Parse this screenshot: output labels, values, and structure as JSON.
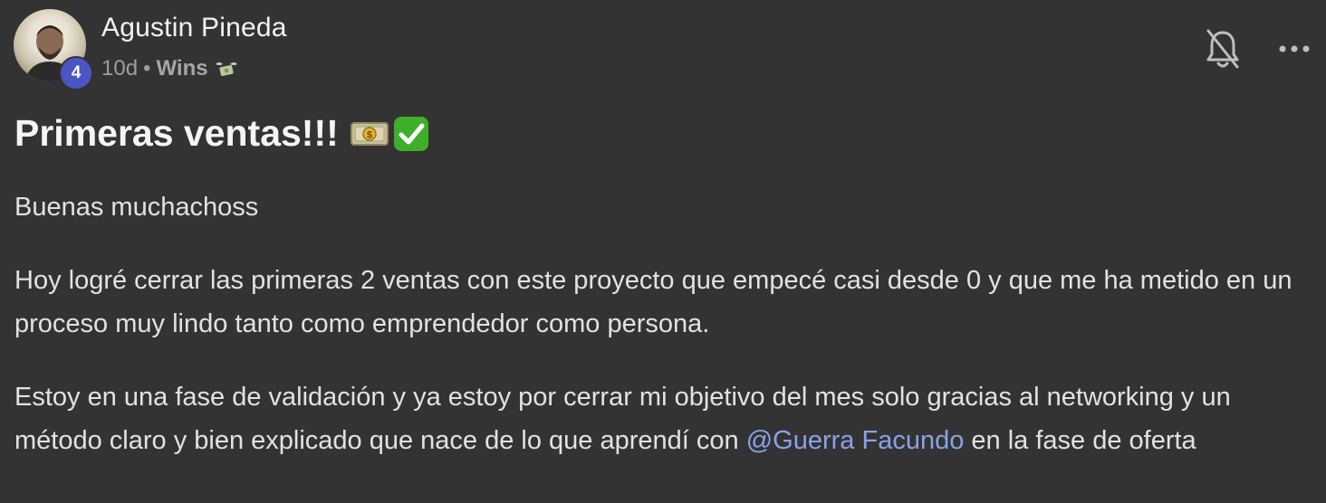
{
  "post": {
    "author": "Agustin Pineda",
    "level": "4",
    "time": "10d",
    "separator": "•",
    "category": "Wins",
    "title": "Primeras ventas!!!",
    "paragraph1": "Buenas muchachoss",
    "paragraph2": "Hoy logré cerrar las primeras 2 ventas con este proyecto que empecé casi desde 0 y que me ha metido en un proceso muy lindo tanto como emprendedor como persona.",
    "paragraph3_before": "Estoy en una fase de validación y ya estoy por cerrar mi objetivo del mes solo gracias al networking y un método claro y bien explicado que nace de lo que aprendí con ",
    "mention": "@Guerra Facundo",
    "paragraph3_after": " en la fase de oferta"
  },
  "icons": {
    "category": "money-with-wings-icon",
    "title_emoji_1": "dollar-banknote-icon",
    "title_emoji_2": "check-mark-button-icon",
    "notifications": "bell-off-icon",
    "more": "more-options-icon"
  },
  "colors": {
    "background": "#333333",
    "badge": "#4b55c4",
    "mention": "#8aa2e6",
    "check_green": "#3fae2a"
  }
}
